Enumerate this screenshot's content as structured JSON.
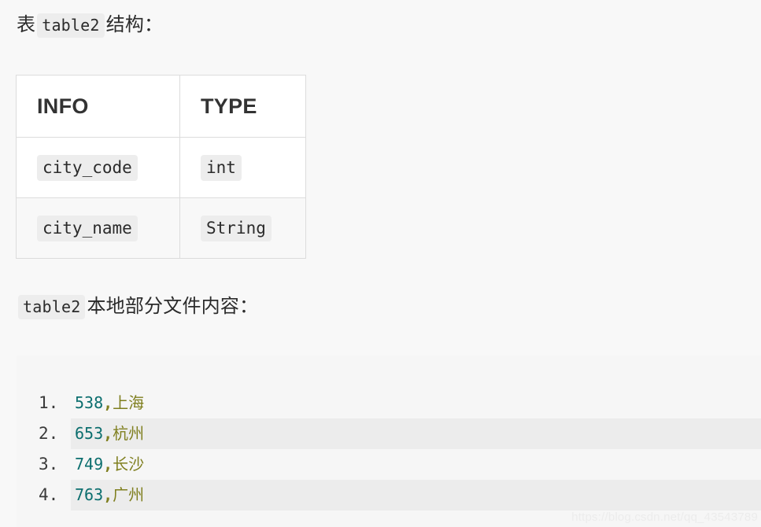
{
  "document": {
    "background_color": "#f8f8f8",
    "paragraph_1": {
      "prefix": "表",
      "code": "table2",
      "suffix": "结构："
    },
    "paragraph_2": {
      "code": "table2",
      "suffix": "本地部分文件内容："
    }
  },
  "table": {
    "headers": [
      "INFO",
      "TYPE"
    ],
    "rows": [
      {
        "info": "city_code",
        "type": "int"
      },
      {
        "info": "city_name",
        "type": "String"
      }
    ],
    "border_color": "#dcdcdc",
    "zebra_color": "#f8f8f8",
    "chip_color": "#ededed"
  },
  "code_block": {
    "background_color": "#f6f6f6",
    "alt_line_color": "#ececec",
    "number_color": "#0b6e6e",
    "text_color": "#7f7f1f",
    "lines": [
      {
        "no": "1.",
        "num": "538",
        "comma": ",",
        "text": "上海"
      },
      {
        "no": "2.",
        "num": "653",
        "comma": ",",
        "text": "杭州"
      },
      {
        "no": "3.",
        "num": "749",
        "comma": ",",
        "text": "长沙"
      },
      {
        "no": "4.",
        "num": "763",
        "comma": ",",
        "text": "广州"
      }
    ]
  },
  "watermark": {
    "text": "https://blog.csdn.net/qq_43543789"
  }
}
